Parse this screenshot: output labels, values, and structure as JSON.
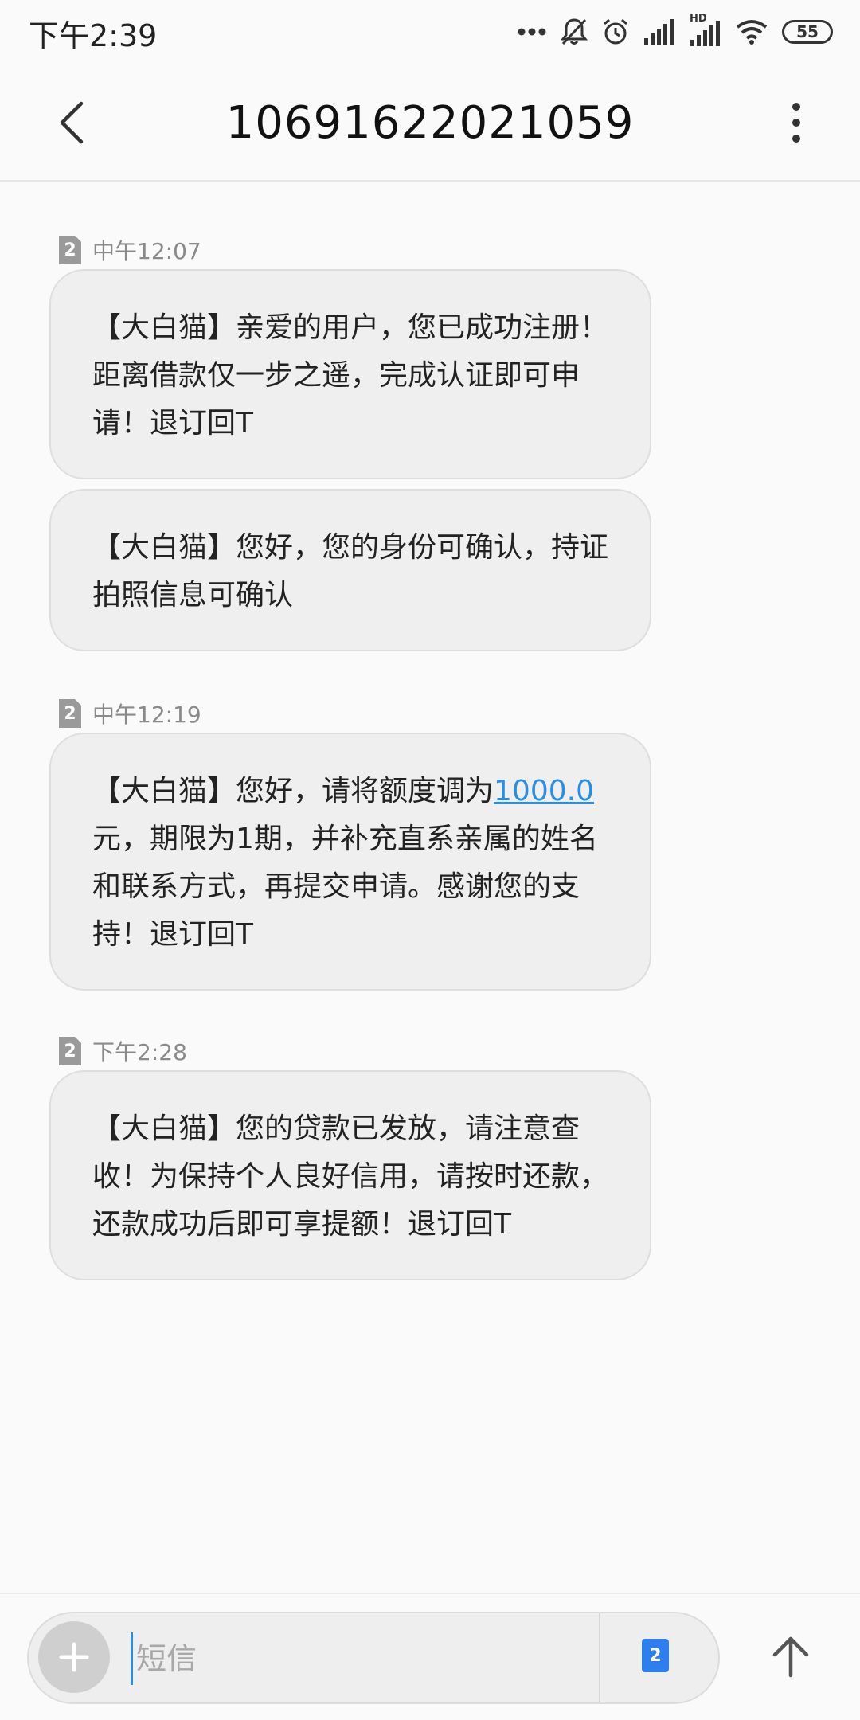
{
  "status_bar": {
    "time": "下午2:39",
    "battery": "55",
    "hd_label": "HD"
  },
  "header": {
    "title": "10691622021059"
  },
  "messages": [
    {
      "timestamp": "中午12:07",
      "sim": "2",
      "bubbles": [
        {
          "text": "【大白猫】亲爱的用户，您已成功注册！距离借款仅一步之遥，完成认证即可申请！退订回T"
        },
        {
          "text": "【大白猫】您好，您的身份可确认，持证拍照信息可确认"
        }
      ]
    },
    {
      "timestamp": "中午12:19",
      "sim": "2",
      "bubbles": [
        {
          "text_before": "【大白猫】您好，请将额度调为",
          "link": "1000.0",
          "text_after": "元，期限为1期，并补充直系亲属的姓名和联系方式，再提交申请。感谢您的支持！退订回T"
        }
      ]
    },
    {
      "timestamp": "下午2:28",
      "sim": "2",
      "bubbles": [
        {
          "text": "【大白猫】您的贷款已发放，请注意查收！为保持个人良好信用，请按时还款，还款成功后即可享提额！退订回T"
        }
      ]
    }
  ],
  "composer": {
    "placeholder": "短信",
    "sim": "2"
  },
  "colors": {
    "link": "#2a8de6",
    "sim_badge": "#9a9a9a",
    "sim_select": "#2d7ff0",
    "bubble_bg": "#efefef"
  },
  "icons": {
    "back": "chevron-left-icon",
    "more": "more-vertical-icon",
    "add": "plus-icon",
    "send": "arrow-up-icon"
  }
}
